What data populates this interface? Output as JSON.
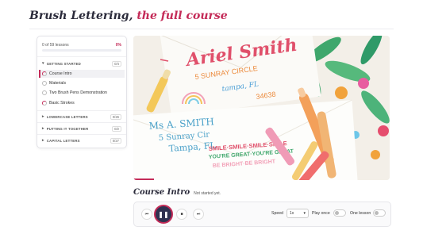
{
  "header": {
    "title_main": "Brush Lettering,",
    "title_accent": "the full course"
  },
  "sidebar": {
    "progress_text": "0 of 59 lessons",
    "progress_percent": "0%",
    "progress_fraction": 0,
    "sections": [
      {
        "name": "GETTING STARTED",
        "count": "0/4",
        "expanded": true,
        "lessons": [
          {
            "label": "Course Intro",
            "active": true,
            "status": "partial"
          },
          {
            "label": "Materials",
            "active": false,
            "status": "none"
          },
          {
            "label": "Two Brush Pens Demonstration",
            "active": false,
            "status": "none"
          },
          {
            "label": "Basic Strokes",
            "active": false,
            "status": "partial"
          }
        ]
      },
      {
        "name": "LOWERCASE LETTERS",
        "count": "0/26",
        "expanded": false
      },
      {
        "name": "PUTTING IT TOGETHER",
        "count": "0/2",
        "expanded": false
      },
      {
        "name": "CAPITAL LETTERS",
        "count": "0/27",
        "expanded": false
      }
    ]
  },
  "lesson": {
    "name": "Course Intro",
    "status": "Not started yet."
  },
  "player": {
    "speed_label": "Speed",
    "speed_value": "1x",
    "play_once_label": "Play once",
    "one_lesson_label": "One lesson",
    "video_progress_fraction": 0.08
  },
  "video_text": {
    "name": "Ariel Smith",
    "address_line1": "5 SUNRAY CIRCLE",
    "address_line2": "tampa, FL",
    "zip": "34638",
    "envelope_name": "Ms A. SMITH",
    "envelope_line1": "5 Sunray Cir",
    "envelope_line2": "Tampa, FL",
    "smile_text": "SMILE·SMILE·SMILE·SMILE",
    "great_text": "YOU'RE GREAT·YOU'RE GREAT",
    "bright_text": "BE BRIGHT·BE BRIGHT"
  },
  "colors": {
    "accent": "#c42b58",
    "navy": "#2f3150"
  }
}
